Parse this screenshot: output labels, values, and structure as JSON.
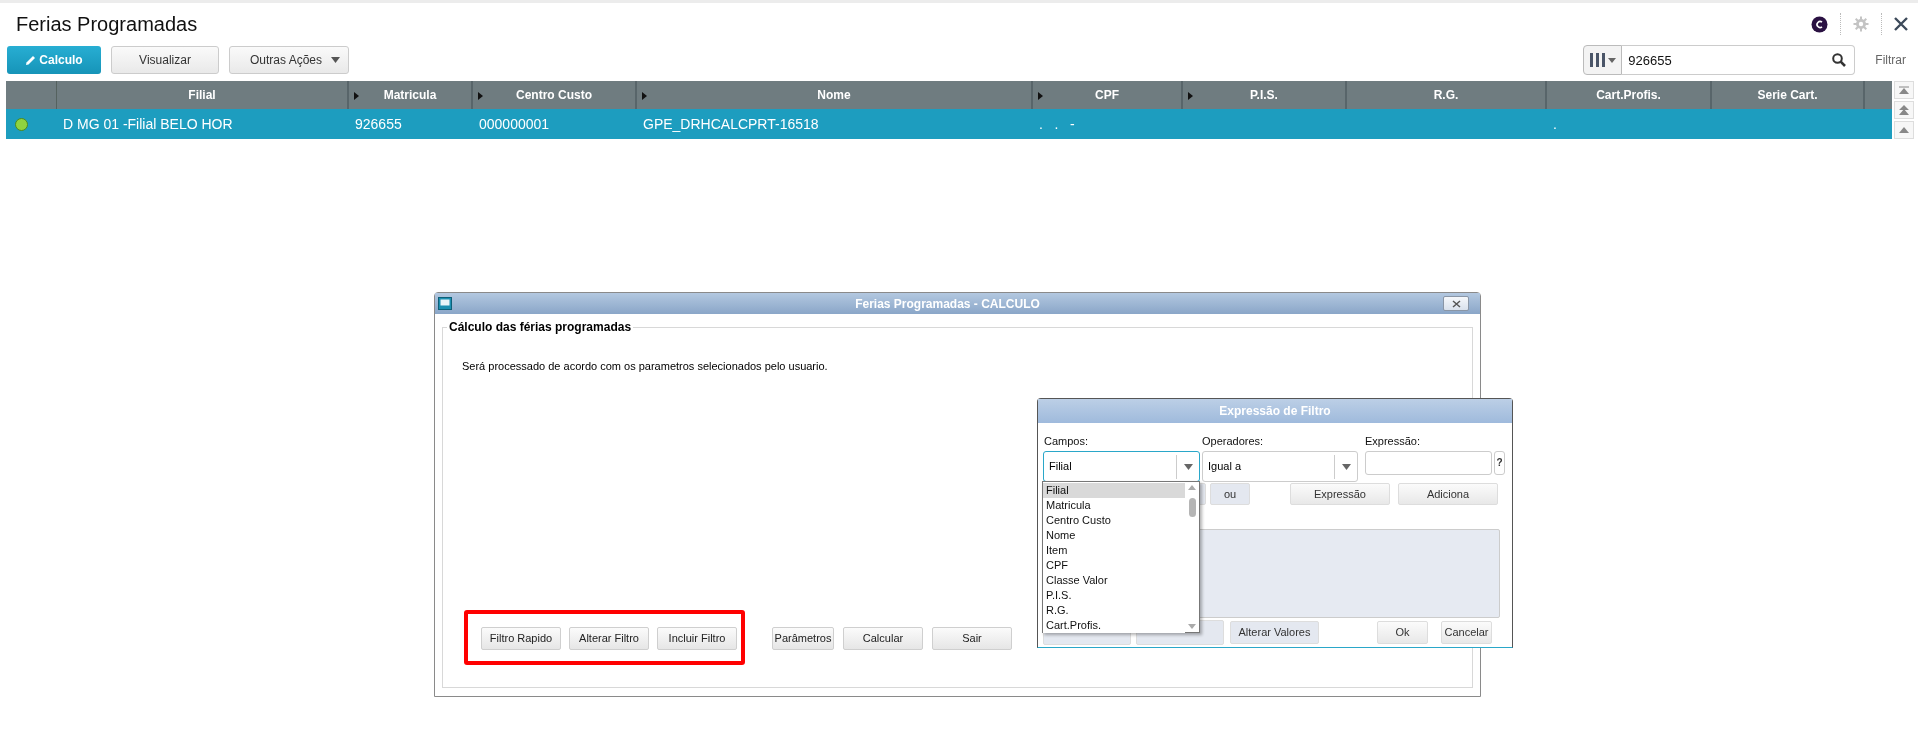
{
  "page": {
    "title": "Ferias Programadas"
  },
  "toolbar": {
    "buttons": [
      {
        "label": "Calculo",
        "kind": "primary"
      },
      {
        "label": "Visualizar",
        "kind": "default"
      },
      {
        "label": "Outras Ações",
        "kind": "menu"
      }
    ]
  },
  "search": {
    "value": "926655",
    "filter_label": "Filtrar"
  },
  "table": {
    "columns": [
      {
        "label": "Filial",
        "arrow": false
      },
      {
        "label": "Matricula",
        "arrow": true
      },
      {
        "label": "Centro Custo",
        "arrow": true
      },
      {
        "label": "Nome",
        "arrow": true
      },
      {
        "label": "CPF",
        "arrow": true
      },
      {
        "label": "P.I.S.",
        "arrow": true
      },
      {
        "label": "R.G.",
        "arrow": false
      },
      {
        "label": "Cart.Profis.",
        "arrow": false
      },
      {
        "label": "Serie Cart.",
        "arrow": false
      }
    ],
    "rows": [
      {
        "selected": true,
        "color": "#8fd33f",
        "cells": [
          "D MG 01 -Filial BELO HOR",
          "926655",
          "000000001",
          "GPE_DRHCALCPRT-16518",
          ".   .   -",
          null,
          null,
          ".",
          null
        ]
      }
    ]
  },
  "calc_dialog": {
    "title": "Ferias Programadas - CALCULO",
    "group_title": "Cálculo das férias programadas",
    "message": "Será processado de acordo com os parametros selecionados pelo usuario.",
    "button_groups": [
      {
        "highlighted": true,
        "buttons": [
          "Filtro Rapido",
          "Alterar Filtro",
          "Incluir Filtro"
        ]
      },
      {
        "highlighted": false,
        "buttons": [
          "Parâmetros",
          "Calcular",
          "Sair"
        ]
      }
    ]
  },
  "filter_dialog": {
    "title": "Expressão de Filtro",
    "campos": {
      "label": "Campos:",
      "value": "Filial",
      "expanded": true,
      "options": [
        {
          "label": "Filial",
          "selected": true
        },
        {
          "label": "Matricula",
          "selected": false
        },
        {
          "label": "Centro Custo",
          "selected": false
        },
        {
          "label": "Nome",
          "selected": false
        },
        {
          "label": "Item",
          "selected": false
        },
        {
          "label": "CPF",
          "selected": false
        },
        {
          "label": "Classe Valor",
          "selected": false
        },
        {
          "label": "P.I.S.",
          "selected": false
        },
        {
          "label": "R.G.",
          "selected": false
        },
        {
          "label": "Cart.Profis.",
          "selected": false
        }
      ]
    },
    "operadores": {
      "label": "Operadores:",
      "value": "Igual a"
    },
    "expressao": {
      "label": "Expressão:",
      "help": "?"
    },
    "row_buttons": [
      "ou",
      "Expressão",
      "Adiciona"
    ],
    "bottom_buttons": [
      "Alterar Valores",
      "Ok",
      "Cancelar"
    ]
  }
}
